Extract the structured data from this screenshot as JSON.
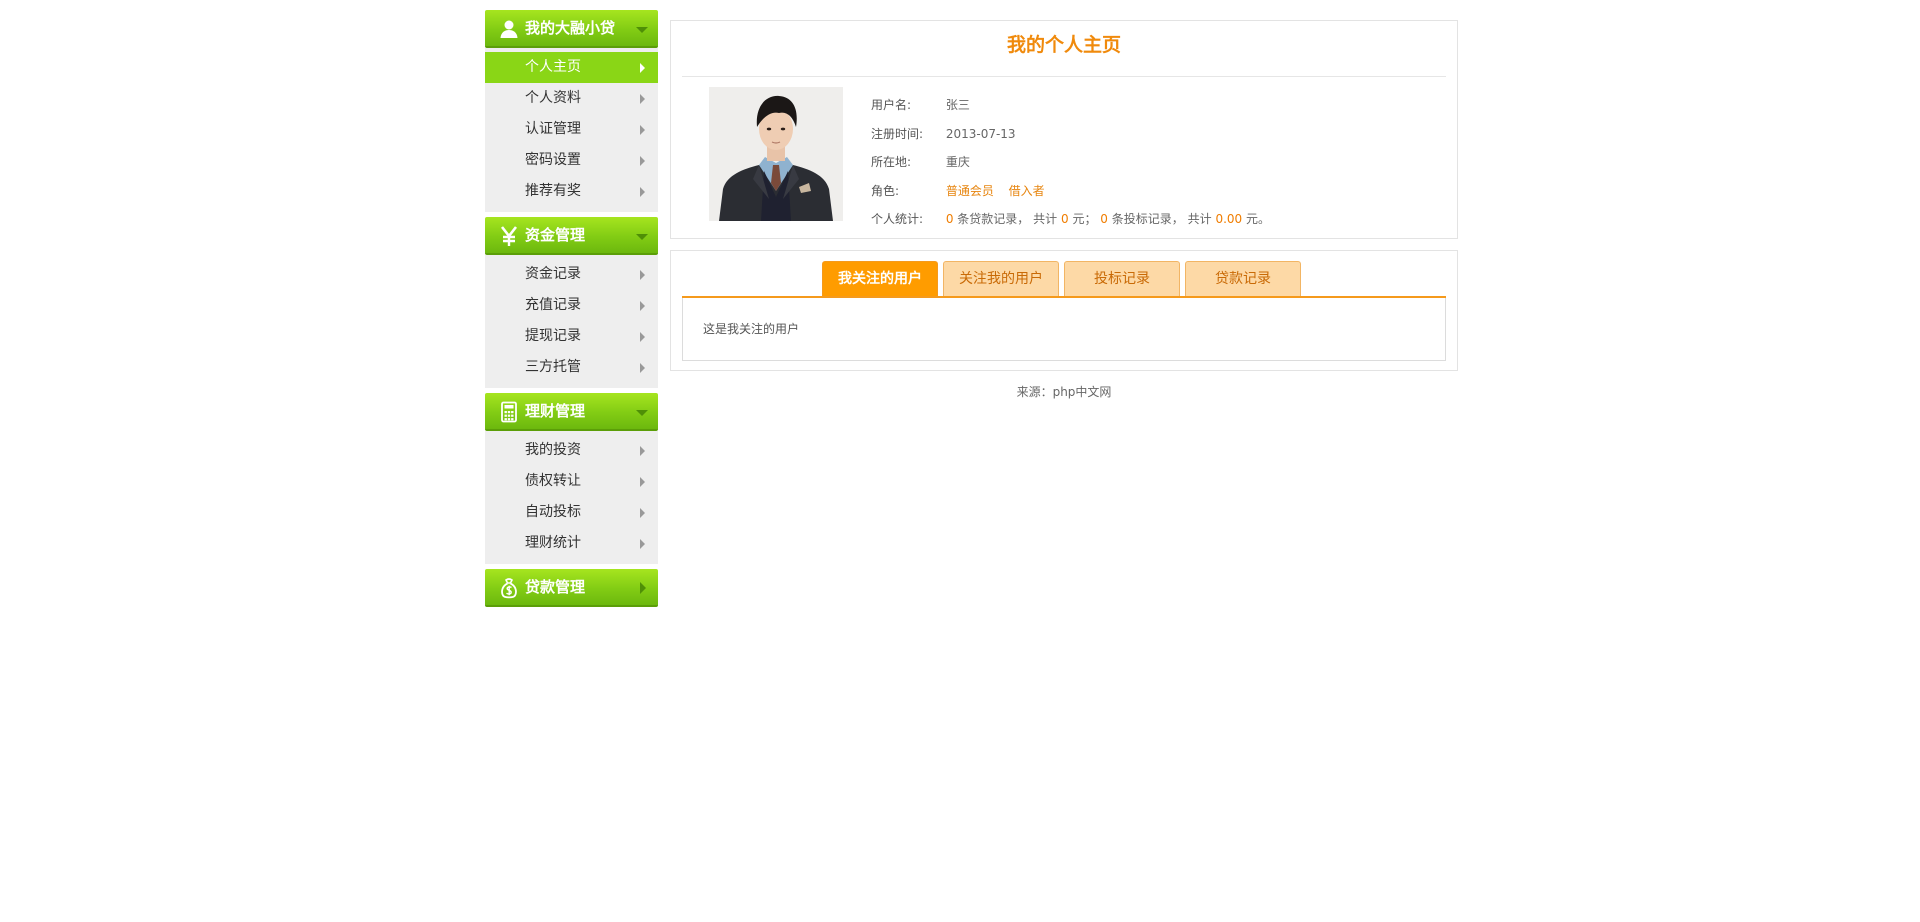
{
  "sidebar": {
    "groups": [
      {
        "title": "我的大融小贷",
        "icon": "user-icon",
        "expanded": true,
        "items": [
          {
            "label": "个人主页",
            "active": true
          },
          {
            "label": "个人资料"
          },
          {
            "label": "认证管理"
          },
          {
            "label": "密码设置"
          },
          {
            "label": "推荐有奖"
          }
        ]
      },
      {
        "title": "资金管理",
        "icon": "yen-icon",
        "expanded": true,
        "items": [
          {
            "label": "资金记录"
          },
          {
            "label": "充值记录"
          },
          {
            "label": "提现记录"
          },
          {
            "label": "三方托管"
          }
        ]
      },
      {
        "title": "理财管理",
        "icon": "calculator-icon",
        "expanded": true,
        "items": [
          {
            "label": "我的投资"
          },
          {
            "label": "债权转让"
          },
          {
            "label": "自动投标"
          },
          {
            "label": "理财统计"
          }
        ]
      },
      {
        "title": "贷款管理",
        "icon": "money-bag-icon",
        "expanded": false,
        "items": []
      }
    ]
  },
  "profile": {
    "title": "我的个人主页",
    "username_label": "用户名:",
    "username": "张三",
    "regtime_label": "注册时间:",
    "regtime": "2013-07-13",
    "location_label": "所在地:",
    "location": "重庆",
    "role_label": "角色:",
    "roles": [
      "普通会员",
      "借入者"
    ],
    "stats_label": "个人统计:",
    "stats": {
      "loan_count": "0",
      "loan_text": "条贷款记录，",
      "total_text_1": "共计",
      "loan_amount": "0",
      "yuan_1": "元；",
      "bid_count": "0",
      "bid_text": "条投标记录，",
      "total_text_2": "共计",
      "bid_amount": "0.00",
      "yuan_2": "元。"
    }
  },
  "tabs": {
    "items": [
      "我关注的用户",
      "关注我的用户",
      "投标记录",
      "贷款记录"
    ],
    "active_index": 0,
    "content": "这是我关注的用户"
  },
  "footer": "来源：php中文网",
  "colors": {
    "accent_green": "#82cc14",
    "accent_orange": "#ff9c00",
    "title_orange": "#f08a0c"
  }
}
